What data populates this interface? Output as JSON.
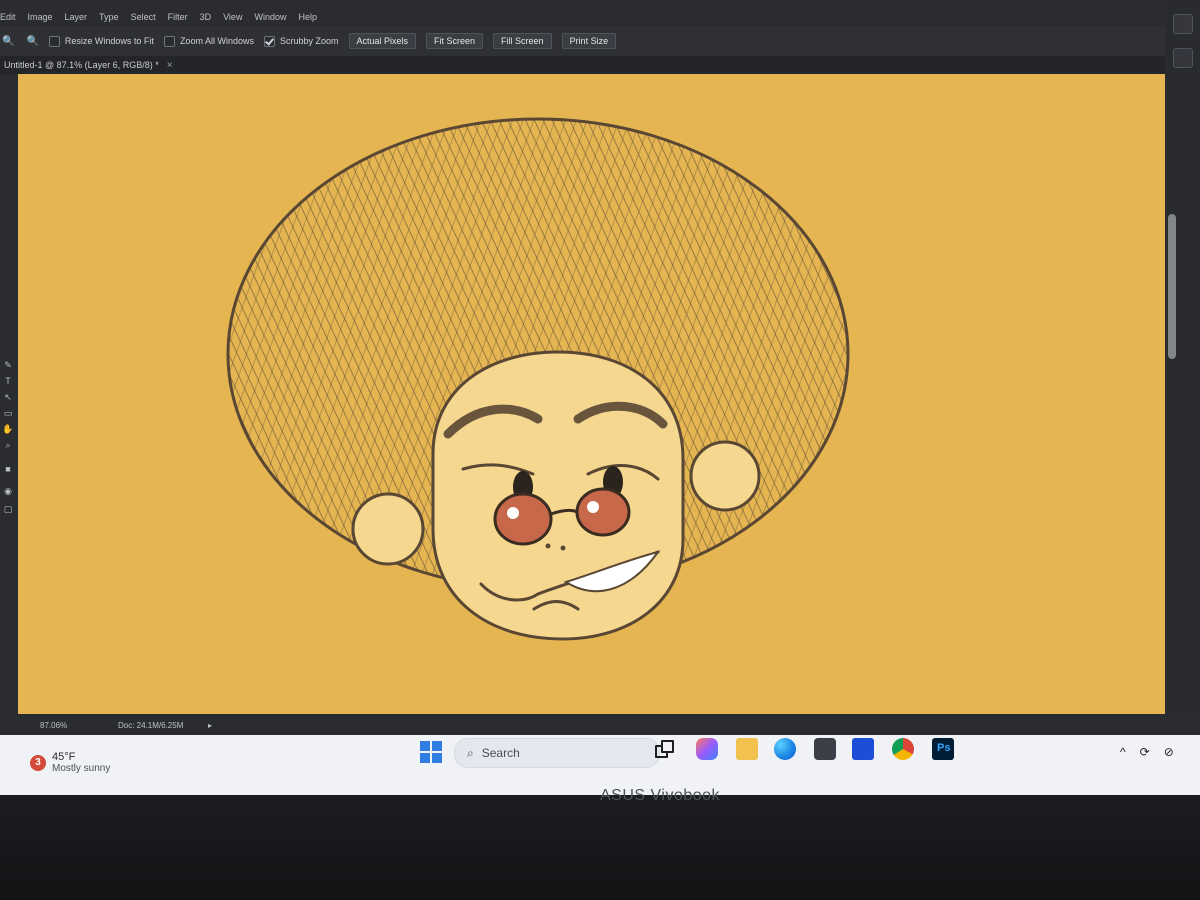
{
  "app": {
    "menu": [
      "Edit",
      "Image",
      "Layer",
      "Type",
      "Select",
      "Filter",
      "3D",
      "View",
      "Window",
      "Help"
    ],
    "options": {
      "resize_windows_to_fit": {
        "label": "Resize Windows to Fit",
        "checked": false
      },
      "zoom_all_windows": {
        "label": "Zoom All Windows",
        "checked": false
      },
      "scrubby_zoom": {
        "label": "Scrubby Zoom",
        "checked": true
      },
      "buttons": [
        "Actual Pixels",
        "Fit Screen",
        "Fill Screen",
        "Print Size"
      ]
    },
    "document_tab": {
      "title": "Untitled-1 @ 87.1% (Layer 6, RGB/8) *",
      "close_glyph": "×"
    },
    "status": {
      "zoom": "87.06%",
      "doc": "Doc: 24.1M/6.25M",
      "arrow": "▸"
    },
    "colors": {
      "canvas_bg": "#e4b551",
      "ink": "#5a4733",
      "skin": "#f5d78f",
      "lens": "#c8684a",
      "tooth": "#ffffff"
    }
  },
  "taskbar": {
    "weather": {
      "badge": "3",
      "temp": "45°F",
      "condition": "Mostly sunny"
    },
    "search": {
      "label": "Search"
    },
    "pinned": [
      "task-view",
      "copilot",
      "file-explorer",
      "edge",
      "store",
      "app",
      "chrome",
      "photoshop"
    ],
    "ps_label": "Ps",
    "tray": [
      "^",
      "⟳",
      "⊘"
    ]
  },
  "hardware": {
    "brand": "ASUS Vivobook"
  }
}
